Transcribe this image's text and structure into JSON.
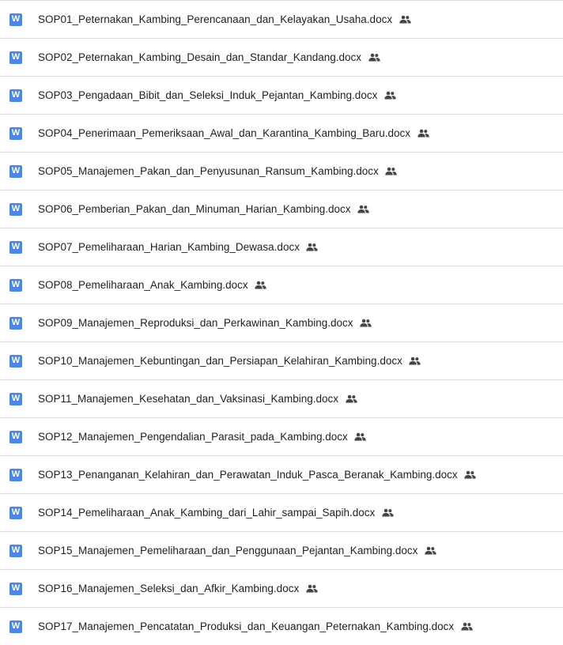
{
  "file_list": {
    "doc_icon_label": "W",
    "icon_color": "#4a86e8",
    "shared_icon": "people-icon",
    "files": [
      {
        "name": "SOP01_Peternakan_Kambing_Perencanaan_dan_Kelayakan_Usaha.docx"
      },
      {
        "name": "SOP02_Peternakan_Kambing_Desain_dan_Standar_Kandang.docx"
      },
      {
        "name": "SOP03_Pengadaan_Bibit_dan_Seleksi_Induk_Pejantan_Kambing.docx"
      },
      {
        "name": "SOP04_Penerimaan_Pemeriksaan_Awal_dan_Karantina_Kambing_Baru.docx"
      },
      {
        "name": "SOP05_Manajemen_Pakan_dan_Penyusunan_Ransum_Kambing.docx"
      },
      {
        "name": "SOP06_Pemberian_Pakan_dan_Minuman_Harian_Kambing.docx"
      },
      {
        "name": "SOP07_Pemeliharaan_Harian_Kambing_Dewasa.docx"
      },
      {
        "name": "SOP08_Pemeliharaan_Anak_Kambing.docx"
      },
      {
        "name": "SOP09_Manajemen_Reproduksi_dan_Perkawinan_Kambing.docx"
      },
      {
        "name": "SOP10_Manajemen_Kebuntingan_dan_Persiapan_Kelahiran_Kambing.docx"
      },
      {
        "name": "SOP11_Manajemen_Kesehatan_dan_Vaksinasi_Kambing.docx"
      },
      {
        "name": "SOP12_Manajemen_Pengendalian_Parasit_pada_Kambing.docx"
      },
      {
        "name": "SOP13_Penanganan_Kelahiran_dan_Perawatan_Induk_Pasca_Beranak_Kambing.docx"
      },
      {
        "name": "SOP14_Pemeliharaan_Anak_Kambing_dari_Lahir_sampai_Sapih.docx"
      },
      {
        "name": "SOP15_Manajemen_Pemeliharaan_dan_Penggunaan_Pejantan_Kambing.docx"
      },
      {
        "name": "SOP16_Manajemen_Seleksi_dan_Afkir_Kambing.docx"
      },
      {
        "name": "SOP17_Manajemen_Pencatatan_Produksi_dan_Keuangan_Peternakan_Kambing.docx"
      }
    ]
  }
}
